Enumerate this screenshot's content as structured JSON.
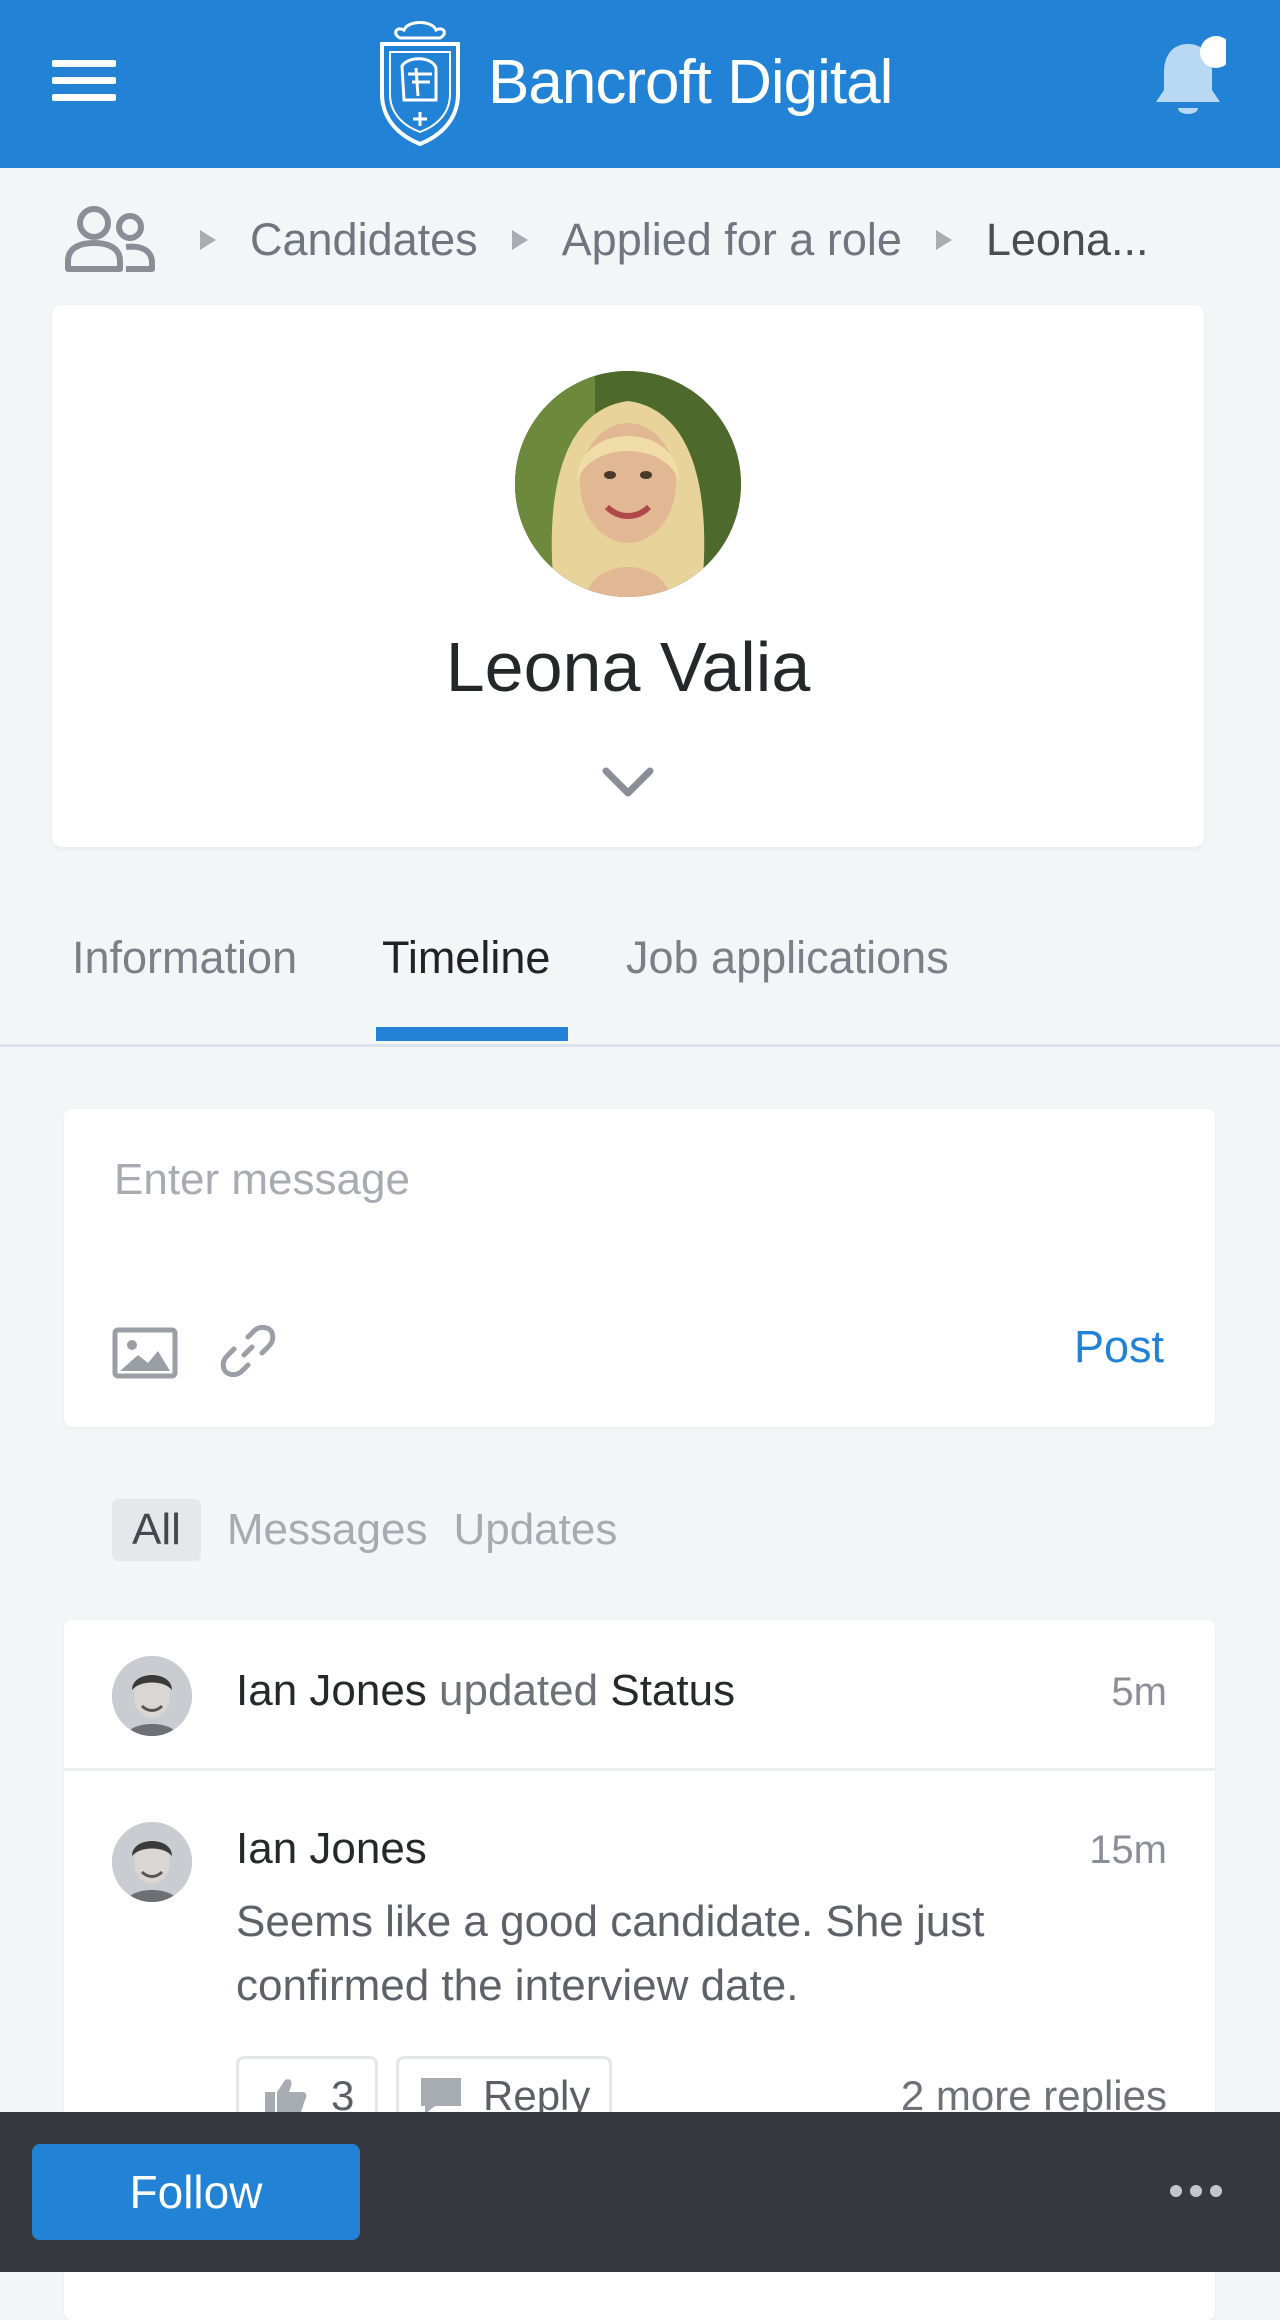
{
  "header": {
    "brand": "Bancroft Digital",
    "menu_icon": "hamburger-menu-icon",
    "logo_icon": "knight-crest-logo",
    "notification_icon": "bell-icon",
    "has_unread_notification": true,
    "accent_color": "#2283d6"
  },
  "breadcrumb": {
    "icon": "people-icon",
    "items": [
      "Candidates",
      "Applied for a role",
      "Leona..."
    ]
  },
  "profile": {
    "name": "Leona Valia",
    "expand_icon": "chevron-down-icon"
  },
  "tabs": {
    "items": [
      "Information",
      "Timeline",
      "Job applications"
    ],
    "active": "Timeline"
  },
  "composer": {
    "placeholder": "Enter message",
    "image_icon": "image-icon",
    "link_icon": "link-icon",
    "post_label": "Post"
  },
  "filters": {
    "items": [
      "All",
      "Messages",
      "Updates"
    ],
    "active": "All"
  },
  "feed": {
    "update": {
      "actor": "Ian Jones",
      "verb": "updated",
      "object": "Status",
      "time": "5m"
    },
    "comment": {
      "author": "Ian Jones",
      "time": "15m",
      "body": "Seems like a good candidate. She just confirmed the interview date.",
      "likes": "3",
      "reply_label": "Reply",
      "more_replies": "2 more replies"
    }
  },
  "bottombar": {
    "follow_label": "Follow",
    "more_icon": "more-horizontal-icon"
  }
}
